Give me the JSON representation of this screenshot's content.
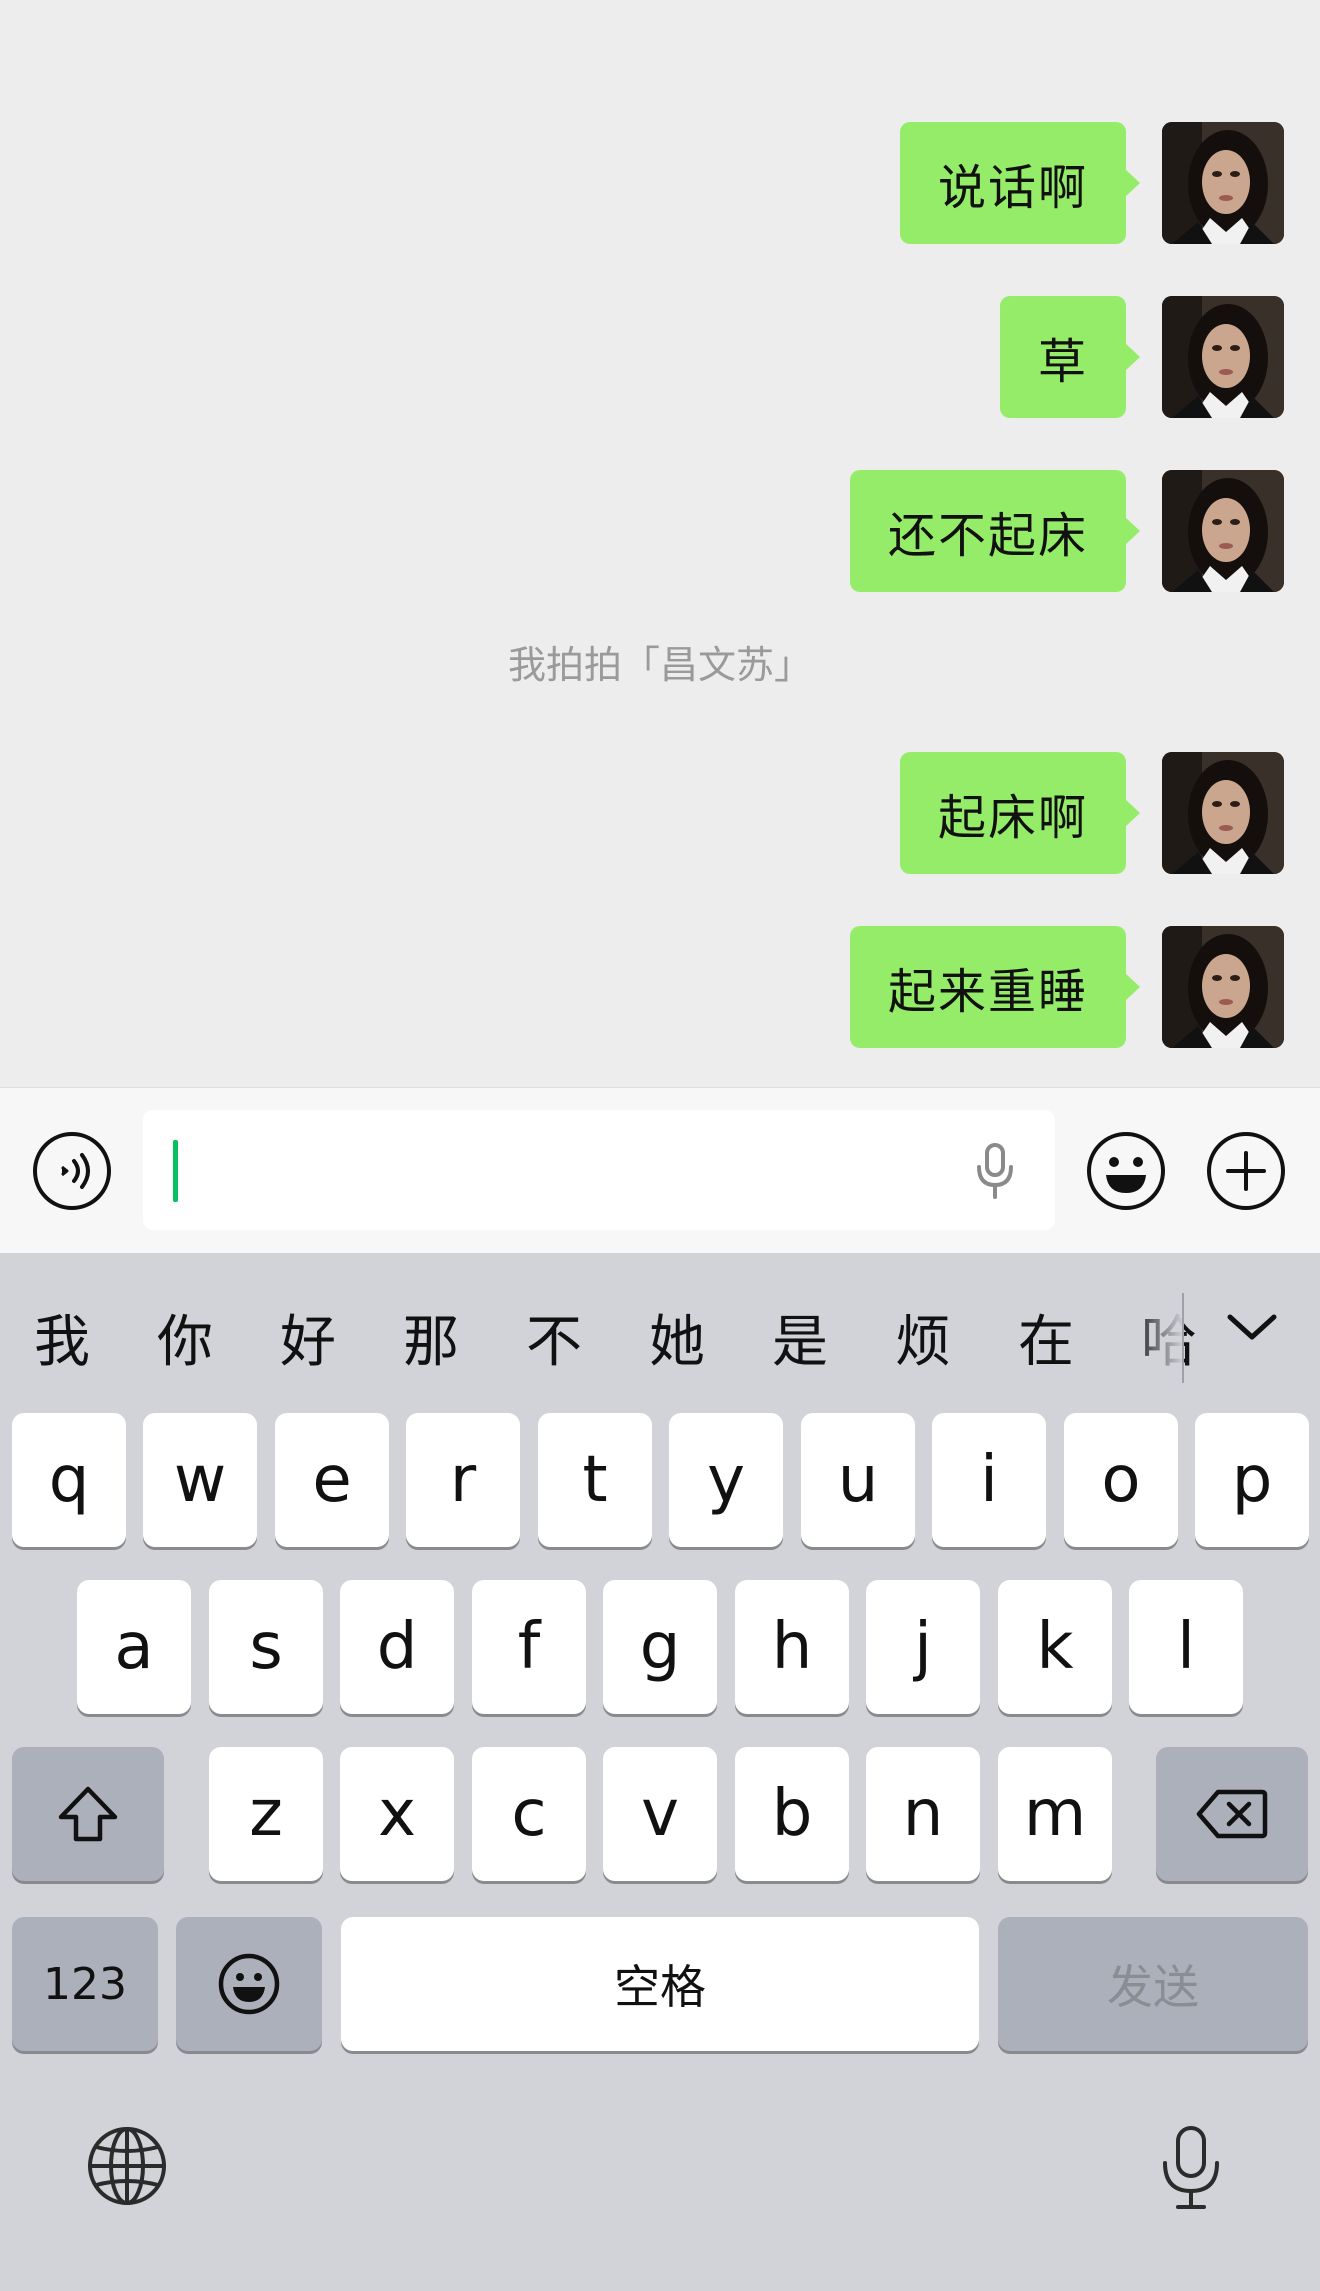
{
  "messages": [
    {
      "text": "说话啊"
    },
    {
      "text": "草"
    },
    {
      "text": "还不起床"
    },
    {
      "text": "起床啊"
    },
    {
      "text": "起来重睡"
    }
  ],
  "system_message": "我拍拍「昌文苏」",
  "input": {
    "value": "",
    "voice_toggle_icon": "voice-wave-icon",
    "field_mic_icon": "microphone-icon",
    "emoji_icon": "smiley-icon",
    "more_icon": "plus-circle-icon"
  },
  "keyboard": {
    "candidates": [
      "我",
      "你",
      "好",
      "那",
      "不",
      "她",
      "是",
      "烦",
      "在",
      "哈"
    ],
    "row1": [
      "q",
      "w",
      "e",
      "r",
      "t",
      "y",
      "u",
      "i",
      "o",
      "p"
    ],
    "row2": [
      "a",
      "s",
      "d",
      "f",
      "g",
      "h",
      "j",
      "k",
      "l"
    ],
    "row3": [
      "z",
      "x",
      "c",
      "v",
      "b",
      "n",
      "m"
    ],
    "numbers_label": "123",
    "space_label": "空格",
    "send_label": "发送",
    "shift_icon": "shift-arrow-icon",
    "delete_icon": "backspace-icon",
    "emoji_key_icon": "smiley-icon",
    "globe_icon": "globe-icon",
    "dictation_icon": "microphone-icon",
    "expand_icon": "chevron-down-icon"
  },
  "colors": {
    "chat_background": "#ededed",
    "bubble": "#95ec69",
    "caret": "#07c160",
    "keyboard_background": "#d1d3d9"
  }
}
